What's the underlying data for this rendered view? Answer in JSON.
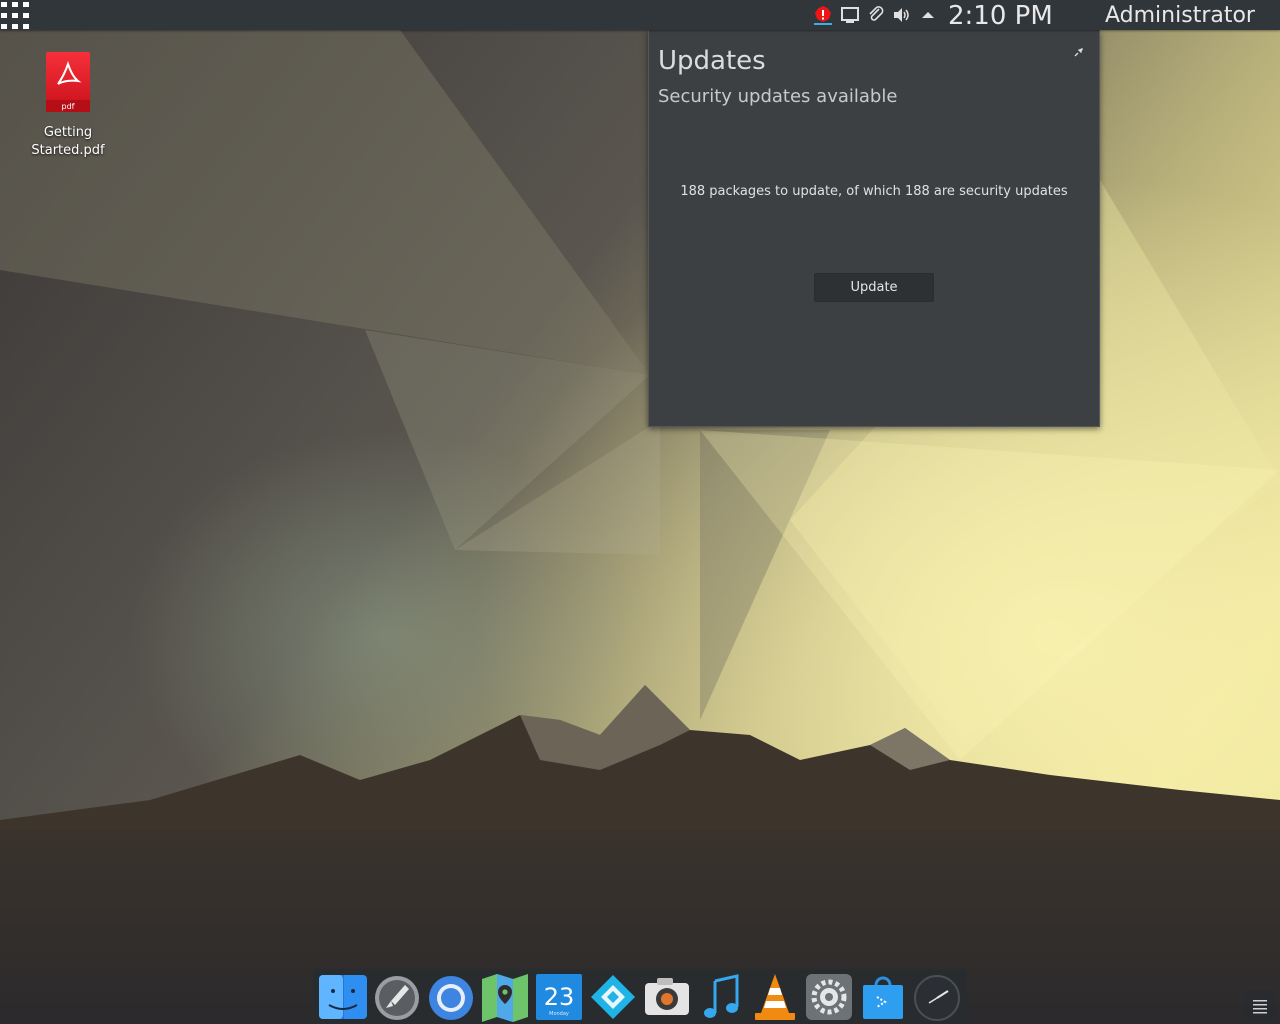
{
  "panel": {
    "clock": "2:10 PM",
    "user": "Administrator",
    "launcher_icon": "app-grid-icon",
    "tray_icons": [
      "security-update-alert-icon",
      "display-icon",
      "clipboard-clip-icon",
      "volume-icon",
      "expand-tray-arrow-icon"
    ],
    "alert_color": "#ed1515"
  },
  "desktop": {
    "icons": [
      {
        "label": "Getting Started.pdf",
        "badge": "pdf"
      }
    ]
  },
  "updates_popup": {
    "title": "Updates",
    "subtitle": "Security updates available",
    "message": "188 packages to update, of which 188 are security updates",
    "button_label": "Update"
  },
  "dock": {
    "apps": [
      "finder-icon",
      "launchpad-rocket-icon",
      "chrome-browser-icon",
      "maps-icon",
      "calendar-icon",
      "kodi-icon",
      "camera-icon",
      "music-note-icon",
      "vlc-cone-icon",
      "system-settings-gear-icon",
      "software-store-bag-icon",
      "clock-icon"
    ],
    "calendar_day": "23",
    "calendar_weekday": "Monday"
  }
}
